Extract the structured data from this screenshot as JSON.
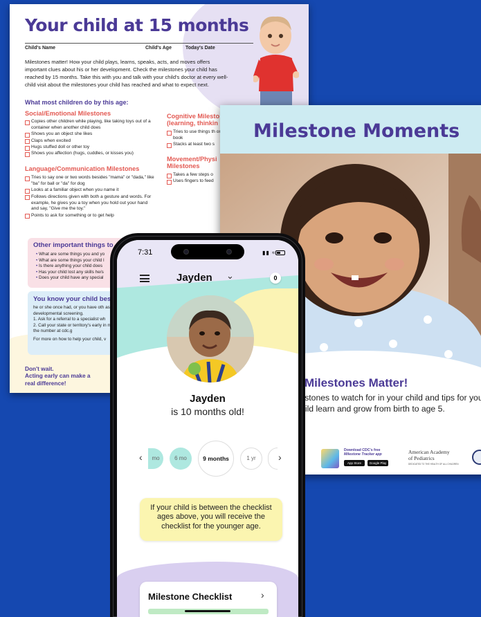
{
  "doc": {
    "title": "Your child at 15 months",
    "fields": {
      "name": "Child's Name",
      "age": "Child's Age",
      "date": "Today's Date"
    },
    "intro": "Milestones matter! How your child plays, learns, speaks, acts, and moves offers important clues about his or her development. Check the milestones your child has reached by 15 months. Take this with you and talk with your child's doctor at every well-child visit about the milestones your child has reached and what to expect next.",
    "what_heading": "What most children do by this age:",
    "social_heading": "Social/Emotional Milestones",
    "social_items": [
      "Copies other children while playing, like taking toys out of a container when another child does",
      "Shows you an object she likes",
      "Claps when excited",
      "Hugs stuffed doll or other toy",
      "Shows you affection (hugs, cuddles, or kisses you)"
    ],
    "language_heading": "Language/Communication Milestones",
    "language_items": [
      "Tries to say one or two words besides \"mama\" or \"dada,\" like \"ba\" for ball or \"da\" for dog",
      "Looks at a familiar object when you name it",
      "Follows directions given with both a gesture and words. For example, he gives you a toy when you hold out your hand and say, \"Give me the toy.\"",
      "Points to ask for something or to get help"
    ],
    "cognitive_heading": "Cognitive Milesto (learning, thinkin",
    "cognitive_items": [
      "Tries to use things th or book",
      "Stacks at least two s"
    ],
    "movement_heading": "Movement/Physi Milestones",
    "movement_items": [
      "Takes a few steps o",
      "Uses fingers to feed"
    ],
    "other_heading": "Other important things to",
    "other_items": [
      "What are some things you and yo",
      "What are some things your child l",
      "Is there anything your child does",
      "Has your child lost any skills he/s",
      "Does your child have any special"
    ],
    "know_heading": "You know your child best.",
    "know_text": "he or she once had, or you have oth ask about developmental screening.",
    "know_step1": "1. Ask for a referral to a specialist wh",
    "know_step2": "2. Call your state or territory's early in more and find the number at cdc.g",
    "know_more": "For more on how to help your child, v",
    "dont_wait": "Don't wait.",
    "acting_early": "Acting early can make a real difference!"
  },
  "poster": {
    "title": "Milestone Moments",
    "heading": "Milestones Matter!",
    "subtitle": "ilestones to watch for in your child and tips for your child learn and grow from birth to age 5.",
    "tracker_line1": "Download CDC's free",
    "tracker_line2": "Milestone Tracker app",
    "app_store": "App Store",
    "google_play": "Google Play",
    "aap_line1": "American Academy",
    "aap_line2": "of Pediatrics",
    "aap_tagline": "DEDICATED TO THE HEALTH OF ALL CHILDREN"
  },
  "app": {
    "time": "7:31",
    "child_name": "Jayden",
    "notifications": "0",
    "profile_name": "Jayden",
    "age_text": "is 10 months old!",
    "ages": [
      "mo",
      "6 mo",
      "9 months",
      "1 yr"
    ],
    "selected_age": "9 months",
    "info_text": "If your child is between the checklist ages above, you will receive the checklist for the younger age.",
    "card_label": "Milestone Checklist"
  },
  "colors": {
    "brand_purple": "#4b3a96",
    "accent_red": "#e35a53",
    "background_blue": "#1548b0",
    "mint": "#aee8e0",
    "yellow": "#fbf5b0",
    "lavender": "#d9cff0"
  }
}
